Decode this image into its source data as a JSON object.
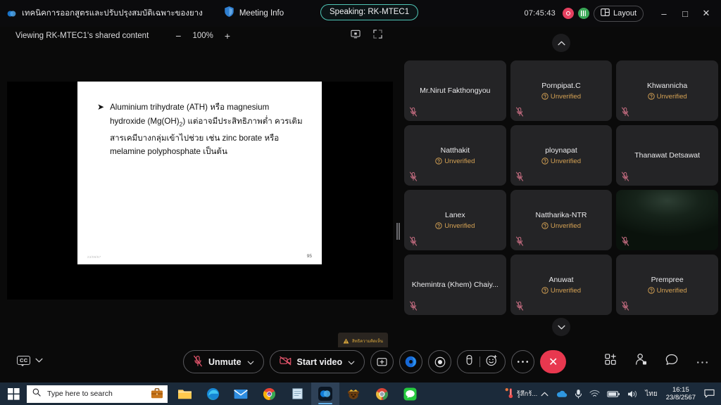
{
  "titlebar": {
    "app_logo": "webex-logo-icon",
    "meeting_title": "เทคนิคการออกสูตรและปรับปรุงสมบัติเฉพาะของยาง",
    "meeting_info_label": "Meeting Info",
    "speaking_badge": "Speaking: RK-MTEC1",
    "clock": "07:45:43",
    "recording_dot": "recording-indicator-icon",
    "audio_dot": "audio-active-indicator-icon",
    "layout_label": "Layout",
    "minimize": "–",
    "maximize": "□",
    "close": "✕",
    "speaking_border_color": "#4fc5b5",
    "record_color": "#e4405f",
    "audio_color": "#3aa757"
  },
  "viewbar": {
    "viewing_text": "Viewing RK-MTEC1's shared content",
    "zoom_out": "−",
    "zoom_level": "100%",
    "zoom_in": "+"
  },
  "slide": {
    "bullet_marker": "➤",
    "line1_a": "Aluminium trihydrate (ATH) ",
    "line1_b": "หรือ",
    "line1_c": " magnesium",
    "line2_a": "hydroxide (Mg(OH)",
    "line2_sub": "2",
    "line2_b": ") แต่อาจมีประสิทธิภาพต่ำ ควรเติม",
    "line3_a": "สารเคมีบางกลุ่มเข้าไปช่วย เช่น ",
    "line3_b": "zinc borate ",
    "line3_c": "หรือ",
    "line4_a": "melamine polyphosphate ",
    "line4_b": "เป็นต้น",
    "footer_left": "23/08/67",
    "page_number": "95",
    "warning_badge": "สิทธิความคิดเห็น"
  },
  "participants": [
    {
      "name": "Mr.Nirut Fakthongyou",
      "unverified": false,
      "muted": true,
      "video": false
    },
    {
      "name": "Pornpipat.C",
      "unverified": true,
      "muted": true,
      "video": false
    },
    {
      "name": "Khwannicha",
      "unverified": true,
      "muted": true,
      "video": false
    },
    {
      "name": "Natthakit",
      "unverified": true,
      "muted": true,
      "video": false
    },
    {
      "name": "ploynapat",
      "unverified": true,
      "muted": true,
      "video": false
    },
    {
      "name": "Thanawat Detsawat",
      "unverified": false,
      "muted": true,
      "video": false
    },
    {
      "name": "Lanex",
      "unverified": true,
      "muted": true,
      "video": false
    },
    {
      "name": "Nattharika-NTR",
      "unverified": true,
      "muted": true,
      "video": false
    },
    {
      "name": "",
      "unverified": false,
      "muted": true,
      "video": true
    },
    {
      "name": "Khemintra (Khem) Chaiy...",
      "unverified": false,
      "muted": true,
      "video": false
    },
    {
      "name": "Anuwat",
      "unverified": true,
      "muted": true,
      "video": false
    },
    {
      "name": "Prempree",
      "unverified": true,
      "muted": true,
      "video": false
    }
  ],
  "labels": {
    "unverified": "Unverified",
    "unverified_color": "#d5a254"
  },
  "toolbar": {
    "cc_label": "CC",
    "mute_label": "Unmute",
    "video_label": "Start video",
    "share_icon": "share-screen-icon",
    "blue_icon": "webex-assistant-icon",
    "record_icon": "record-icon",
    "annotate_icon": "annotate-icon",
    "reactions_icon": "reactions-icon",
    "more_icon": "more-options-icon",
    "end_icon": "✕",
    "apps_icon": "apps-icon",
    "participants_icon": "participants-icon",
    "chat_icon": "chat-icon",
    "more_right_icon": "more-icon",
    "end_color": "#e8384f"
  },
  "taskbar": {
    "start_icon": "windows-start-icon",
    "search_placeholder": "Type here to search",
    "search_icon": "search-icon",
    "briefcase_icon": "briefcase-icon",
    "apps": [
      "file-explorer-icon",
      "microsoft-edge-icon",
      "mail-icon",
      "chrome-b-icon",
      "notepad-icon",
      "webex-icon",
      "bear-icon",
      "chrome-icon",
      "line-icon"
    ],
    "weather_text": "รู้สึกร้...",
    "tray_chevron": "chevron-up-icon",
    "onedrive_icon": "onedrive-icon",
    "mic_icon": "microphone-icon",
    "wifi_icon": "wifi-icon",
    "battery_icon": "battery-icon",
    "volume_icon": "volume-icon",
    "language": "ไทย",
    "clock_time": "16:15",
    "clock_date": "23/8/2567",
    "notification_icon": "notification-icon"
  }
}
